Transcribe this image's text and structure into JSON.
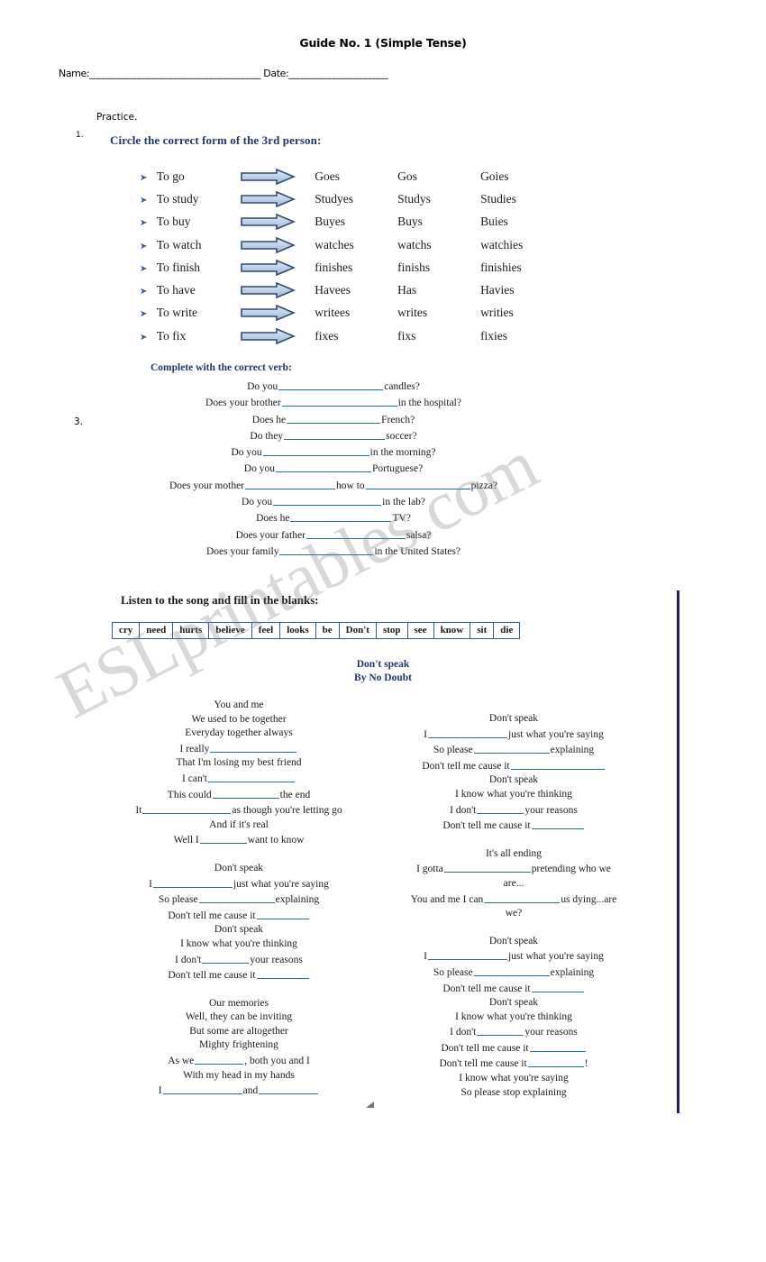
{
  "document": {
    "title": "Guide No. 1 (Simple Tense)",
    "name_label": "Name:",
    "name_rule": "______________________________________",
    "date_label": "Date:",
    "date_rule": "______________________",
    "practice_label": "Practice."
  },
  "exercise1": {
    "number": "1.",
    "heading": "Circle the correct form of the 3rd person:",
    "bullet_glyph": "➤",
    "rows": [
      {
        "verb": "To go",
        "options": [
          "Goes",
          "Gos",
          "Goies"
        ]
      },
      {
        "verb": "To study",
        "options": [
          "Studyes",
          "Studys",
          "Studies"
        ]
      },
      {
        "verb": "To buy",
        "options": [
          "Buyes",
          "Buys",
          "Buies"
        ]
      },
      {
        "verb": "To watch",
        "options": [
          "watches",
          "watchs",
          "watchies"
        ]
      },
      {
        "verb": "To finish",
        "options": [
          "finishes",
          "finishs",
          "finishies"
        ]
      },
      {
        "verb": "To have",
        "options": [
          "Havees",
          "Has",
          "Havies"
        ]
      },
      {
        "verb": "To write",
        "options": [
          "writees",
          "writes",
          "writies"
        ]
      },
      {
        "verb": "To fix",
        "options": [
          "fixes",
          "fixs",
          "fixies"
        ]
      }
    ]
  },
  "exercise3": {
    "number": "3.",
    "heading": "Complete with the correct verb:",
    "questions": [
      {
        "pre": "Do you",
        "blank": 116,
        "post": "candles?",
        "post2": "",
        "blank2": 0
      },
      {
        "pre": "Does your brother",
        "blank": 128,
        "post": "in the hospital?",
        "post2": "",
        "blank2": 0
      },
      {
        "pre": "Does he",
        "blank": 104,
        "post": "French?",
        "post2": "",
        "blank2": 0
      },
      {
        "pre": "Do they",
        "blank": 112,
        "post": "soccer?",
        "post2": "",
        "blank2": 0
      },
      {
        "pre": "Do you",
        "blank": 118,
        "post": "in the morning?",
        "post2": "",
        "blank2": 0
      },
      {
        "pre": "Do you",
        "blank": 106,
        "post": "Portuguese?",
        "post2": "",
        "blank2": 0
      },
      {
        "pre": "Does your mother",
        "blank": 100,
        "post": "how to",
        "post2": "pizza?",
        "blank2": 116
      },
      {
        "pre": "Do you",
        "blank": 120,
        "post": "in the lab?",
        "post2": "",
        "blank2": 0
      },
      {
        "pre": "Does he",
        "blank": 112,
        "post": "TV?",
        "post2": "",
        "blank2": 0
      },
      {
        "pre": "Does your father",
        "blank": 110,
        "post": "salsa?",
        "post2": "",
        "blank2": 0
      },
      {
        "pre": "Does your family",
        "blank": 104,
        "post": "in the United States?",
        "post2": "",
        "blank2": 0
      }
    ]
  },
  "song_exercise": {
    "heading": "Listen to the song and fill in the blanks:",
    "word_bank": [
      "cry",
      "need",
      "hurts",
      "believe",
      "feel",
      "looks",
      "be",
      "Don't",
      "stop",
      "see",
      "know",
      "sit",
      "die"
    ],
    "song_title": "Don't speak",
    "song_artist": "By No Doubt",
    "left_column": [
      {
        "lines": [
          {
            "pre": "You and me",
            "blank": 0,
            "post": "",
            "post2": "",
            "blank2": 0
          },
          {
            "pre": "We used to be together",
            "blank": 0,
            "post": "",
            "post2": "",
            "blank2": 0
          },
          {
            "pre": "Everyday together always",
            "blank": 0,
            "post": "",
            "post2": "",
            "blank2": 0
          },
          {
            "pre": "I really",
            "blank": 96,
            "post": "",
            "post2": "",
            "blank2": 0
          },
          {
            "pre": "That I'm losing my best friend",
            "blank": 0,
            "post": "",
            "post2": "",
            "blank2": 0
          },
          {
            "pre": "I can't",
            "blank": 96,
            "post": "",
            "post2": "",
            "blank2": 0
          },
          {
            "pre": "This could",
            "blank": 74,
            "post": "the end",
            "post2": "",
            "blank2": 0
          },
          {
            "pre": "It",
            "blank": 98,
            "post": "as though you're letting go",
            "post2": "",
            "blank2": 0
          },
          {
            "pre": "And if it's real",
            "blank": 0,
            "post": "",
            "post2": "",
            "blank2": 0
          },
          {
            "pre": "Well I",
            "blank": 52,
            "post": "want to know",
            "post2": "",
            "blank2": 0
          }
        ]
      },
      {
        "lines": [
          {
            "pre": "Don't speak",
            "blank": 0,
            "post": "",
            "post2": "",
            "blank2": 0
          },
          {
            "pre": "I",
            "blank": 88,
            "post": "just what you're saying",
            "post2": "",
            "blank2": 0
          },
          {
            "pre": "So please",
            "blank": 84,
            "post": "explaining",
            "post2": "",
            "blank2": 0
          },
          {
            "pre": "Don't tell me cause it",
            "blank": 58,
            "post": "",
            "post2": "",
            "blank2": 0
          },
          {
            "pre": "Don't speak",
            "blank": 0,
            "post": "",
            "post2": "",
            "blank2": 0
          },
          {
            "pre": "I know what you're thinking",
            "blank": 0,
            "post": "",
            "post2": "",
            "blank2": 0
          },
          {
            "pre": "I don't",
            "blank": 52,
            "post": "your reasons",
            "post2": "",
            "blank2": 0
          },
          {
            "pre": "Don't tell me cause it",
            "blank": 58,
            "post": "",
            "post2": "",
            "blank2": 0
          }
        ]
      },
      {
        "lines": [
          {
            "pre": "Our memories",
            "blank": 0,
            "post": "",
            "post2": "",
            "blank2": 0
          },
          {
            "pre": "Well, they can be inviting",
            "blank": 0,
            "post": "",
            "post2": "",
            "blank2": 0
          },
          {
            "pre": "But some are altogether",
            "blank": 0,
            "post": "",
            "post2": "",
            "blank2": 0
          },
          {
            "pre": "Mighty frightening",
            "blank": 0,
            "post": "",
            "post2": "",
            "blank2": 0
          },
          {
            "pre": "As we",
            "blank": 54,
            "post": ", both you and I",
            "post2": "",
            "blank2": 0
          },
          {
            "pre": "With my head in my hands",
            "blank": 0,
            "post": "",
            "post2": "",
            "blank2": 0
          },
          {
            "pre": "I",
            "blank": 88,
            "post": "and",
            "post2": "",
            "blank2": 66
          }
        ]
      }
    ],
    "right_column": [
      {
        "lines": [
          {
            "pre": "Don't speak",
            "blank": 0,
            "post": "",
            "post2": "",
            "blank2": 0
          },
          {
            "pre": "I",
            "blank": 88,
            "post": "just what you're saying",
            "post2": "",
            "blank2": 0
          },
          {
            "pre": "So please",
            "blank": 84,
            "post": "explaining",
            "post2": "",
            "blank2": 0
          },
          {
            "pre": "Don't tell me cause it",
            "blank": 104,
            "post": "",
            "post2": "",
            "blank2": 0
          },
          {
            "pre": "Don't speak",
            "blank": 0,
            "post": "",
            "post2": "",
            "blank2": 0
          },
          {
            "pre": "I know what you're thinking",
            "blank": 0,
            "post": "",
            "post2": "",
            "blank2": 0
          },
          {
            "pre": "I don't",
            "blank": 52,
            "post": "your reasons",
            "post2": "",
            "blank2": 0
          },
          {
            "pre": "Don't tell me cause it",
            "blank": 58,
            "post": "",
            "post2": "",
            "blank2": 0
          }
        ]
      },
      {
        "lines": [
          {
            "pre": "It's all ending",
            "blank": 0,
            "post": "",
            "post2": "",
            "blank2": 0
          },
          {
            "pre": "I gotta",
            "blank": 96,
            "post": "pretending who we",
            "post2": "",
            "blank2": 0
          },
          {
            "pre": "are...",
            "blank": 0,
            "post": "",
            "post2": "",
            "blank2": 0
          },
          {
            "pre": "You and me I can",
            "blank": 84,
            "post": "us dying...are",
            "post2": "",
            "blank2": 0
          },
          {
            "pre": "we?",
            "blank": 0,
            "post": "",
            "post2": "",
            "blank2": 0
          }
        ]
      },
      {
        "lines": [
          {
            "pre": "Don't speak",
            "blank": 0,
            "post": "",
            "post2": "",
            "blank2": 0
          },
          {
            "pre": "I",
            "blank": 88,
            "post": "just what you're saying",
            "post2": "",
            "blank2": 0
          },
          {
            "pre": "So please",
            "blank": 84,
            "post": "explaining",
            "post2": "",
            "blank2": 0
          },
          {
            "pre": "Don't tell me cause it",
            "blank": 58,
            "post": "",
            "post2": "",
            "blank2": 0
          },
          {
            "pre": "Don't speak",
            "blank": 0,
            "post": "",
            "post2": "",
            "blank2": 0
          },
          {
            "pre": "I know what you're thinking",
            "blank": 0,
            "post": "",
            "post2": "",
            "blank2": 0
          },
          {
            "pre": "I don't",
            "blank": 52,
            "post": "your reasons",
            "post2": "",
            "blank2": 0
          },
          {
            "pre": "Don't tell me cause it",
            "blank": 62,
            "post": "",
            "post2": "",
            "blank2": 0
          },
          {
            "pre": "Don't tell me cause it",
            "blank": 62,
            "post": "!",
            "post2": "",
            "blank2": 0
          },
          {
            "pre": "I know what you're saying",
            "blank": 0,
            "post": "",
            "post2": "",
            "blank2": 0
          },
          {
            "pre": "So please stop explaining",
            "blank": 0,
            "post": "",
            "post2": "",
            "blank2": 0
          }
        ]
      }
    ]
  },
  "watermark": {
    "text": "ESLprintables.com"
  },
  "colors": {
    "heading_navy": "#1F3864",
    "blank_line": "#1F6E9C",
    "rule_navy": "#1F1F6E",
    "arrow_outline": "#2E4B72",
    "arrow_fill": "#BFD0E5"
  }
}
